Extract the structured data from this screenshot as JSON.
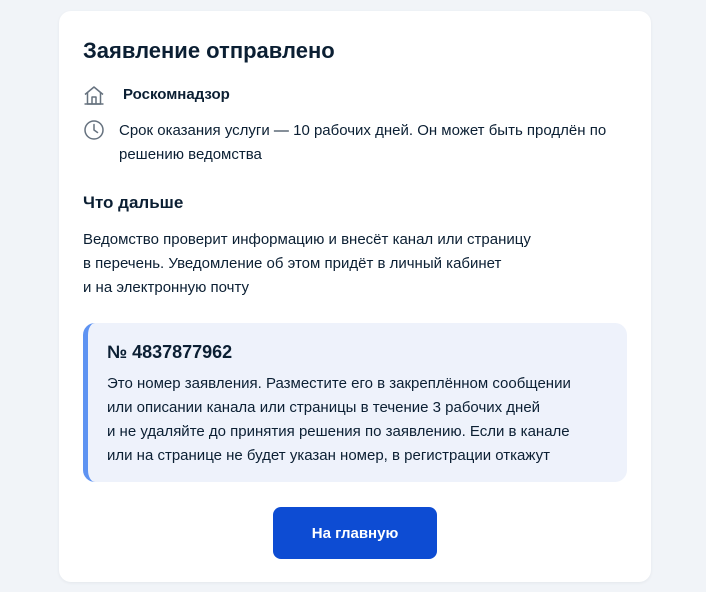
{
  "card": {
    "title": "Заявление отправлено",
    "agency": {
      "icon": "building-icon",
      "name": "Роскомнадзор"
    },
    "term": {
      "icon": "clock-icon",
      "text": "Срок оказания услуги — 10 рабочих дней. Он может быть продлён по решению ведомства"
    },
    "next_steps": {
      "title": "Что дальше",
      "lines": [
        "Ведомство проверит информацию и внесёт канал или страницу",
        "в перечень. Уведомление об этом придёт в личный кабинет",
        "и на электронную почту"
      ]
    },
    "notice": {
      "number": "№ 4837877962",
      "lines": [
        "Это номер заявления. Разместите его в закреплённом сообщении",
        "или описании канала или страницы в течение 3 рабочих дней",
        "и не удаляйте до принятия решения по заявлению. Если в канале",
        "или на странице не будет указан номер, в регистрации откажут"
      ]
    },
    "button_label": "На главную"
  },
  "colors": {
    "background": "#f1f4f8",
    "text": "#0b1f33",
    "accent": "#0d4cd3",
    "notice_background": "#eef2fb",
    "notice_border": "#5e93f2",
    "icon": "#66727f"
  }
}
